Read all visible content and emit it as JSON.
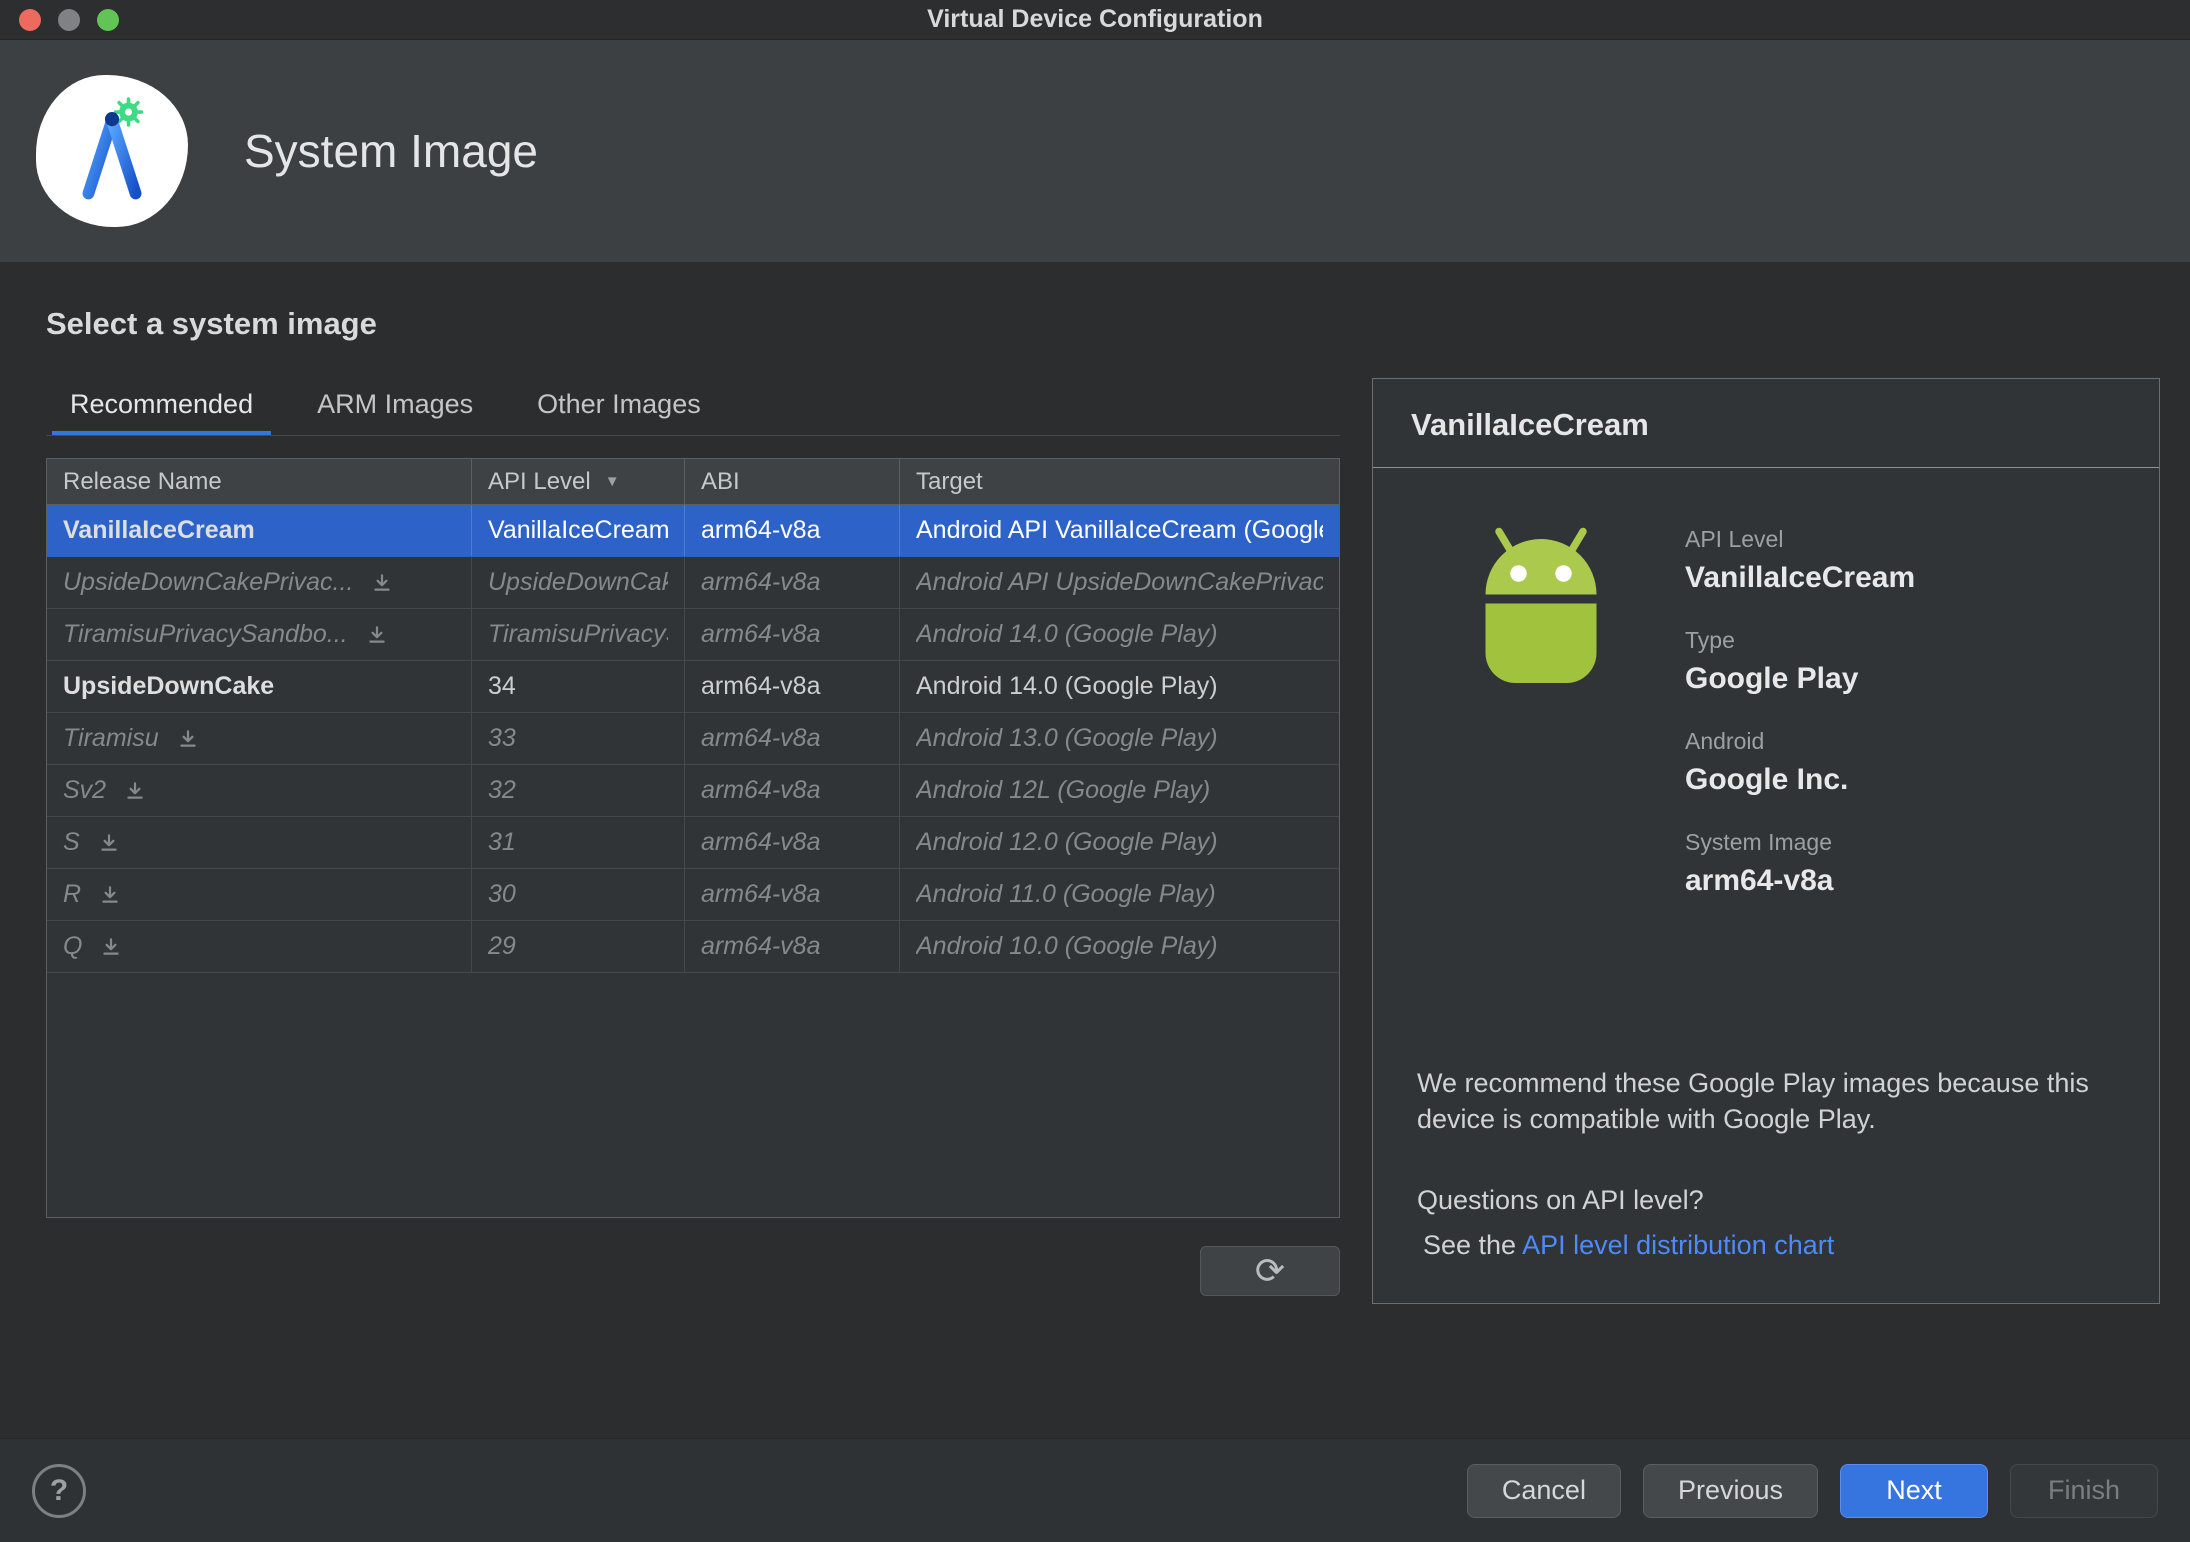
{
  "window": {
    "title": "Virtual Device Configuration"
  },
  "header": {
    "title": "System Image"
  },
  "icons": {
    "refresh": "⟳",
    "sort": "▼",
    "download": "download-arrow"
  },
  "content": {
    "heading": "Select a system image",
    "tabs": [
      {
        "label": "Recommended",
        "active": true
      },
      {
        "label": "ARM Images",
        "active": false
      },
      {
        "label": "Other Images",
        "active": false
      }
    ],
    "table": {
      "columns": [
        {
          "label": "Release Name"
        },
        {
          "label": "API Level",
          "sort": "desc"
        },
        {
          "label": "ABI"
        },
        {
          "label": "Target"
        }
      ],
      "rows": [
        {
          "release": "VanillaIceCream",
          "api": "VanillaIceCream",
          "abi": "arm64-v8a",
          "target": "Android API VanillaIceCream (Google Play)",
          "selected": true,
          "emphasis": "bold",
          "download": false
        },
        {
          "release": "UpsideDownCakePrivac...",
          "api": "UpsideDownCakePrivacySandbox",
          "abi": "arm64-v8a",
          "target": "Android API UpsideDownCakePrivacySandbox",
          "dimmed": true,
          "download": true
        },
        {
          "release": "TiramisuPrivacySandbo...",
          "api": "TiramisuPrivacySandbox",
          "abi": "arm64-v8a",
          "target": "Android 14.0 (Google Play)",
          "dimmed": true,
          "download": true
        },
        {
          "release": "UpsideDownCake",
          "api": "34",
          "abi": "arm64-v8a",
          "target": "Android 14.0 (Google Play)",
          "emphasis": "bold",
          "download": false
        },
        {
          "release": "Tiramisu",
          "api": "33",
          "abi": "arm64-v8a",
          "target": "Android 13.0 (Google Play)",
          "dimmed": true,
          "download": true
        },
        {
          "release": "Sv2",
          "api": "32",
          "abi": "arm64-v8a",
          "target": "Android 12L (Google Play)",
          "dimmed": true,
          "download": true
        },
        {
          "release": "S",
          "api": "31",
          "abi": "arm64-v8a",
          "target": "Android 12.0 (Google Play)",
          "dimmed": true,
          "download": true
        },
        {
          "release": "R",
          "api": "30",
          "abi": "arm64-v8a",
          "target": "Android 11.0 (Google Play)",
          "dimmed": true,
          "download": true
        },
        {
          "release": "Q",
          "api": "29",
          "abi": "arm64-v8a",
          "target": "Android 10.0 (Google Play)",
          "dimmed": true,
          "download": true
        }
      ]
    }
  },
  "detail": {
    "title": "VanillaIceCream",
    "fields": [
      {
        "label": "API Level",
        "value": "VanillaIceCream"
      },
      {
        "label": "Type",
        "value": "Google Play"
      },
      {
        "label": "Android",
        "value": "Google Inc."
      },
      {
        "label": "System Image",
        "value": "arm64-v8a"
      }
    ],
    "recommendation": "We recommend these Google Play images because this device is compatible with Google Play.",
    "question": "Questions on API level?",
    "link_prefix": "See the",
    "link_label": "API level distribution chart"
  },
  "footer": {
    "help_label": "?",
    "buttons": [
      {
        "label": "Cancel",
        "style": "default"
      },
      {
        "label": "Previous",
        "style": "default"
      },
      {
        "label": "Next",
        "style": "primary"
      },
      {
        "label": "Finish",
        "style": "disabled"
      }
    ]
  },
  "colors": {
    "accent": "#3674e0",
    "selection": "#2d63c9",
    "link": "#4e8af9",
    "android_green": "#a0c23d"
  }
}
